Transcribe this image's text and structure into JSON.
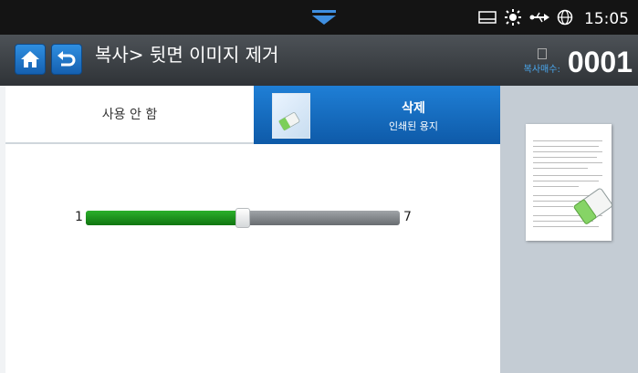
{
  "status": {
    "time": "15:05"
  },
  "header": {
    "title": "복사> 뒷면 이미지 제거",
    "copy_count_label": "복사매수:",
    "copy_count_value": "0001"
  },
  "tabs": [
    {
      "label": "사용 안 함",
      "selected": false
    },
    {
      "label": "삭제",
      "sublabel": "인쇄된 용지",
      "selected": true
    }
  ],
  "slider": {
    "min_label": "1",
    "max_label": "7",
    "min": 1,
    "max": 7,
    "value": 4
  },
  "colors": {
    "accent": "#1a74c8",
    "fill": "#1f9a1f",
    "header": "#3b3f44"
  }
}
